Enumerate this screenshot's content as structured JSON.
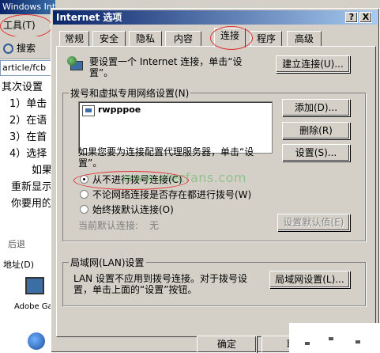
{
  "background_window": {
    "title": "Windows Internet Exp",
    "menu_tools": "工具(T)",
    "search_label": "搜索",
    "address_value": "article/fcb",
    "article_lines": [
      "其次设置",
      "1）单击",
      "2）在语",
      "3）在首",
      "4）选择",
      "如果",
      "重新显示",
      "你要用的"
    ],
    "back_label": "后退",
    "address_label": "地址(D)",
    "desktop_icon_label": "Adobe Gam"
  },
  "dialog": {
    "title": "Internet 选项",
    "help_button": "?",
    "close_button": "X",
    "tabs": [
      {
        "label": "常规",
        "active": false
      },
      {
        "label": "安全",
        "active": false
      },
      {
        "label": "隐私",
        "active": false
      },
      {
        "label": "内容",
        "active": false
      },
      {
        "label": "连接",
        "active": true
      },
      {
        "label": "程序",
        "active": false
      },
      {
        "label": "高级",
        "active": false
      }
    ],
    "setup": {
      "line1": "要设置一个 Internet 连接，单击“设",
      "line2": "置”。",
      "button": "建立连接(U)..."
    },
    "dialup": {
      "group_label": "拨号和虚拟专用网络设置(N)",
      "connections": [
        "rwpppoe"
      ],
      "add_button": "添加(D)...",
      "remove_button": "删除(R)",
      "settings_button": "设置(S)...",
      "proxy_text_line1": "如果您要为连接配置代理服务器，单击“设",
      "proxy_text_line2": "置”。",
      "radio_options": [
        {
          "label": "从不进行拨号连接(C)",
          "checked": true
        },
        {
          "label": "不论网络连接是否存在都进行拨号(W)",
          "checked": false
        },
        {
          "label": "始终拨默认连接(O)",
          "checked": false
        }
      ],
      "current_default_label": "当前默认连接:",
      "current_default_value": "无",
      "set_default_button": "设置默认值(E)"
    },
    "lan": {
      "group_label": "局域网(LAN)设置",
      "text_line1": "LAN 设置不应用到拨号连接。对于拨号设",
      "text_line2": "置，单击上面的“设置”按钮。",
      "button": "局域网设置(L)..."
    },
    "ok_button": "确定",
    "cancel_button": "取"
  },
  "watermark": "www.elecfans.com",
  "accent_colors": {
    "annotation_circle": "#e03030",
    "titlebar": "#0a246a"
  }
}
